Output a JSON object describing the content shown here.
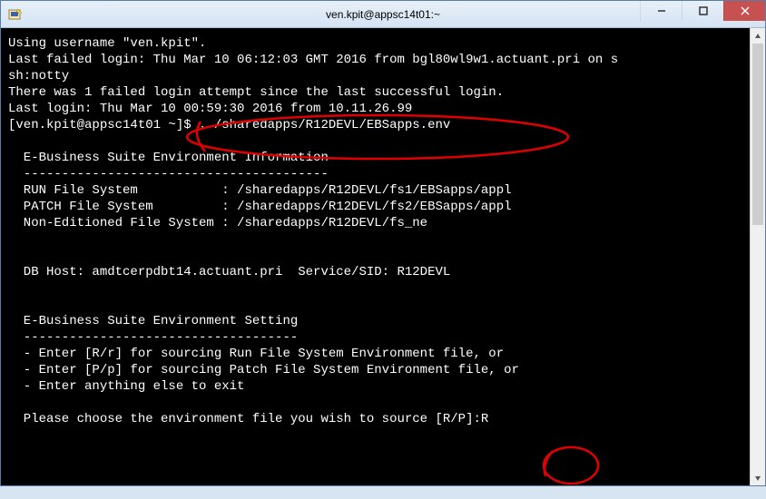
{
  "window": {
    "title": "ven.kpit@appsc14t01:~"
  },
  "terminal": {
    "lines": [
      "Using username \"ven.kpit\".",
      "Last failed login: Thu Mar 10 06:12:03 GMT 2016 from bgl80wl9w1.actuant.pri on s",
      "sh:notty",
      "There was 1 failed login attempt since the last successful login.",
      "Last login: Thu Mar 10 00:59:30 2016 from 10.11.26.99",
      "[ven.kpit@appsc14t01 ~]$ . /sharedapps/R12DEVL/EBSapps.env",
      "",
      "  E-Business Suite Environment Information",
      "  ----------------------------------------",
      "  RUN File System           : /sharedapps/R12DEVL/fs1/EBSapps/appl",
      "  PATCH File System         : /sharedapps/R12DEVL/fs2/EBSapps/appl",
      "  Non-Editioned File System : /sharedapps/R12DEVL/fs_ne",
      "",
      "",
      "  DB Host: amdtcerpdbt14.actuant.pri  Service/SID: R12DEVL",
      "",
      "",
      "  E-Business Suite Environment Setting",
      "  ------------------------------------",
      "  - Enter [R/r] for sourcing Run File System Environment file, or",
      "  - Enter [P/p] for sourcing Patch File System Environment file, or",
      "  - Enter anything else to exit",
      "",
      "  Please choose the environment file you wish to source [R/P]:R"
    ]
  }
}
